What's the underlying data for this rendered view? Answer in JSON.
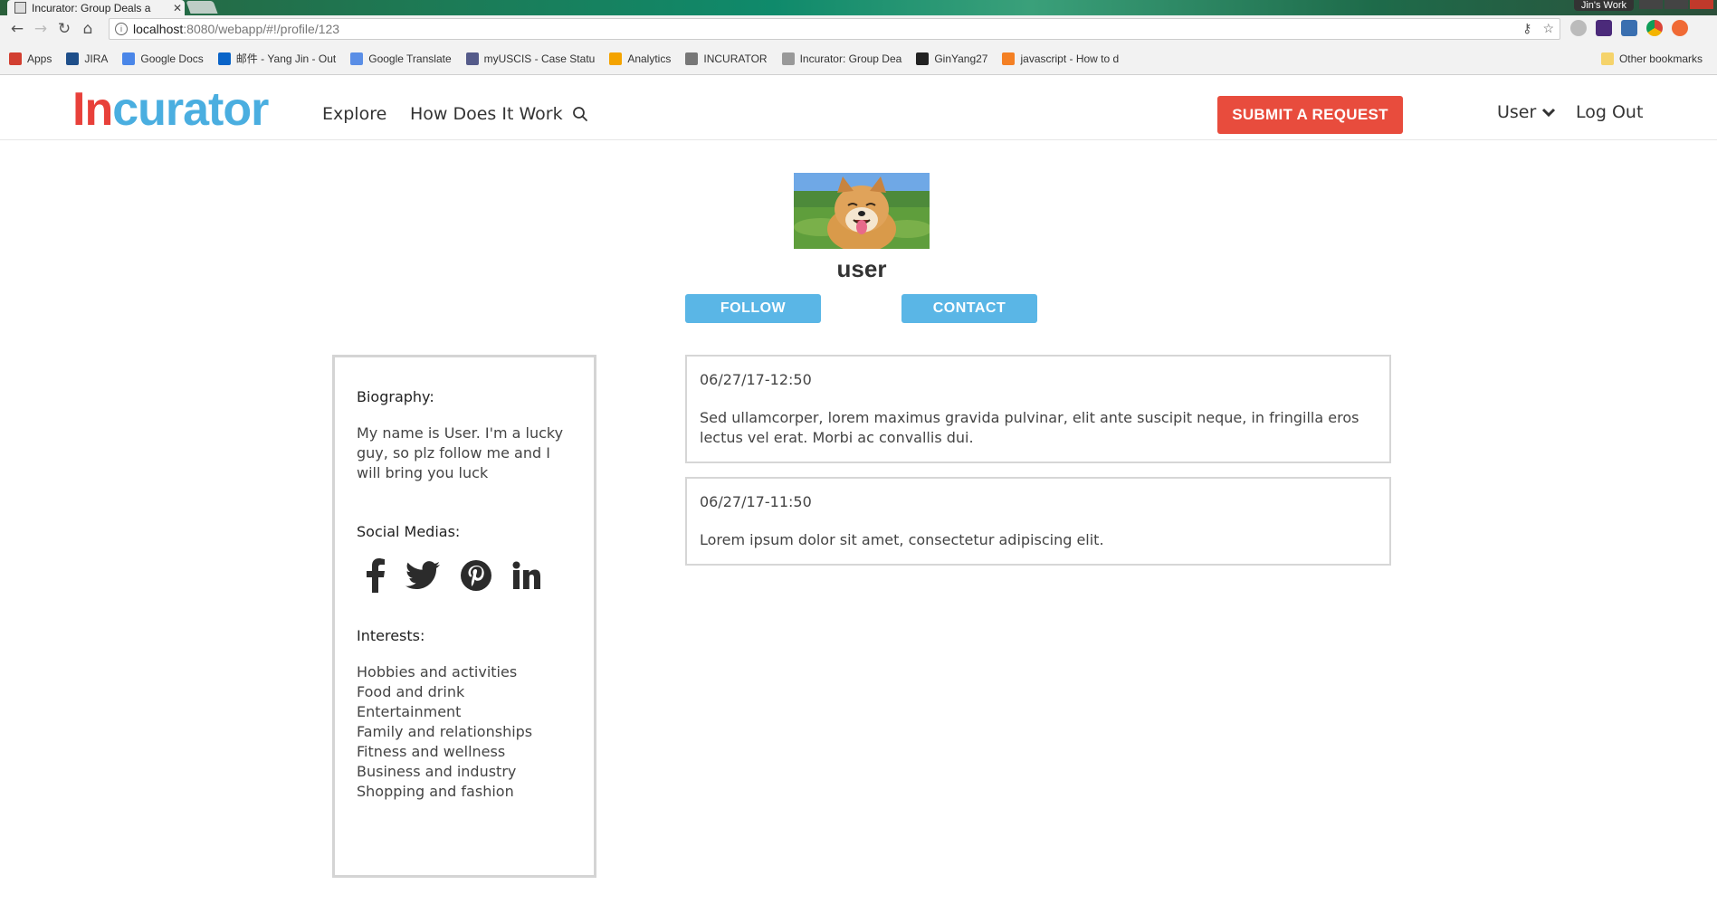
{
  "browser": {
    "tab_title": "Incurator: Group Deals a",
    "url_host": "localhost",
    "url_path": ":8080/webapp/#!/profile/123",
    "window_label": "Jin's Work",
    "bookmarks": [
      {
        "label": "Apps",
        "icon": "apps-grid-icon",
        "color": "#d23f31"
      },
      {
        "label": "JIRA",
        "icon": "jira-icon",
        "color": "#1f4f8a"
      },
      {
        "label": "Google Docs",
        "icon": "google-docs-icon",
        "color": "#4a86e8"
      },
      {
        "label": "邮件 - Yang Jin - Out",
        "icon": "outlook-icon",
        "color": "#0a64c8"
      },
      {
        "label": "Google Translate",
        "icon": "google-translate-icon",
        "color": "#5a8ee6"
      },
      {
        "label": "myUSCIS - Case Statu",
        "icon": "uscis-seal-icon",
        "color": "#555b8a"
      },
      {
        "label": "Analytics",
        "icon": "analytics-icon",
        "color": "#f4a300"
      },
      {
        "label": "INCURATOR",
        "icon": "incurator-bookmark-icon",
        "color": "#777777"
      },
      {
        "label": "Incurator: Group Dea",
        "icon": "page-icon",
        "color": "#999999"
      },
      {
        "label": "GinYang27",
        "icon": "github-icon",
        "color": "#222222"
      },
      {
        "label": "javascript - How to d",
        "icon": "stackoverflow-icon",
        "color": "#f48024"
      }
    ],
    "other_bookmarks": "Other bookmarks"
  },
  "header": {
    "logo_in": "In",
    "logo_rest": "curator",
    "nav": [
      "Explore",
      "How Does It Work"
    ],
    "submit_label": "SUBMIT A REQUEST",
    "user_label": "User",
    "logout_label": "Log Out",
    "colors": {
      "brand_red": "#e8403a",
      "brand_blue": "#4aaee0",
      "submit_bg": "#e84c3d"
    }
  },
  "profile": {
    "username": "user",
    "follow_label": "FOLLOW",
    "contact_label": "CONTACT",
    "button_color": "#5ab6e6"
  },
  "sidebar": {
    "bio_heading": "Biography:",
    "bio_text": "My name is User. I'm a lucky guy, so plz follow me and I will bring you luck",
    "social_heading": "Social Medias:",
    "social_icons": [
      "facebook-icon",
      "twitter-icon",
      "pinterest-icon",
      "linkedin-icon"
    ],
    "interests_heading": "Interests:",
    "interests": [
      "Hobbies and activities",
      "Food and drink",
      "Entertainment",
      "Family and relationships",
      "Fitness and wellness",
      "Business and industry",
      "Shopping and fashion"
    ]
  },
  "posts": [
    {
      "date": "06/27/17-12:50",
      "text": "Sed ullamcorper, lorem maximus gravida pulvinar, elit ante suscipit neque, in fringilla eros lectus vel erat. Morbi ac convallis dui."
    },
    {
      "date": "06/27/17-11:50",
      "text": "Lorem ipsum dolor sit amet, consectetur adipiscing elit."
    }
  ]
}
